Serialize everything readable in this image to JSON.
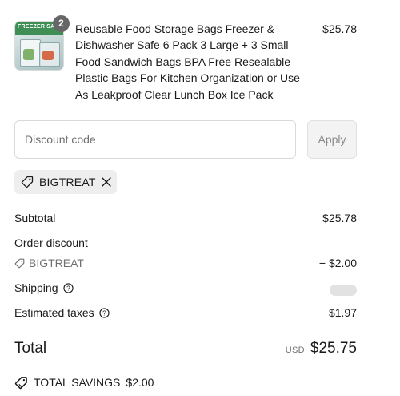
{
  "line_item": {
    "quantity": "2",
    "thumbnail_text": "FREEZER SAFE",
    "title": "Reusable Food Storage Bags Freezer & Dishwasher Safe 6 Pack 3 Large + 3 Small Food Sandwich Bags BPA Free Resealable Plastic Bags For Kitchen Organization or Use As Leakproof Clear Lunch Box Ice Pack",
    "price": "$25.78"
  },
  "discount": {
    "placeholder": "Discount code",
    "value": "",
    "apply_label": "Apply",
    "applied_code": "BIGTREAT"
  },
  "summary": {
    "subtotal_label": "Subtotal",
    "subtotal_value": "$25.78",
    "order_discount_label": "Order discount",
    "discount_code": "BIGTREAT",
    "discount_value": "− $2.00",
    "shipping_label": "Shipping",
    "taxes_label": "Estimated taxes",
    "taxes_value": "$1.97",
    "total_label": "Total",
    "currency": "USD",
    "total_value": "$25.75",
    "savings_label": "TOTAL SAVINGS",
    "savings_value": "$2.00"
  },
  "icons": {
    "tag": "tag-icon",
    "close": "close-icon",
    "info": "info-icon",
    "savings": "savings-tag-icon"
  },
  "colors": {
    "text": "#1a1a1a",
    "muted": "#707070",
    "chip_bg": "#eeeeee",
    "badge_bg": "#666666",
    "border": "#d9d9d9"
  }
}
